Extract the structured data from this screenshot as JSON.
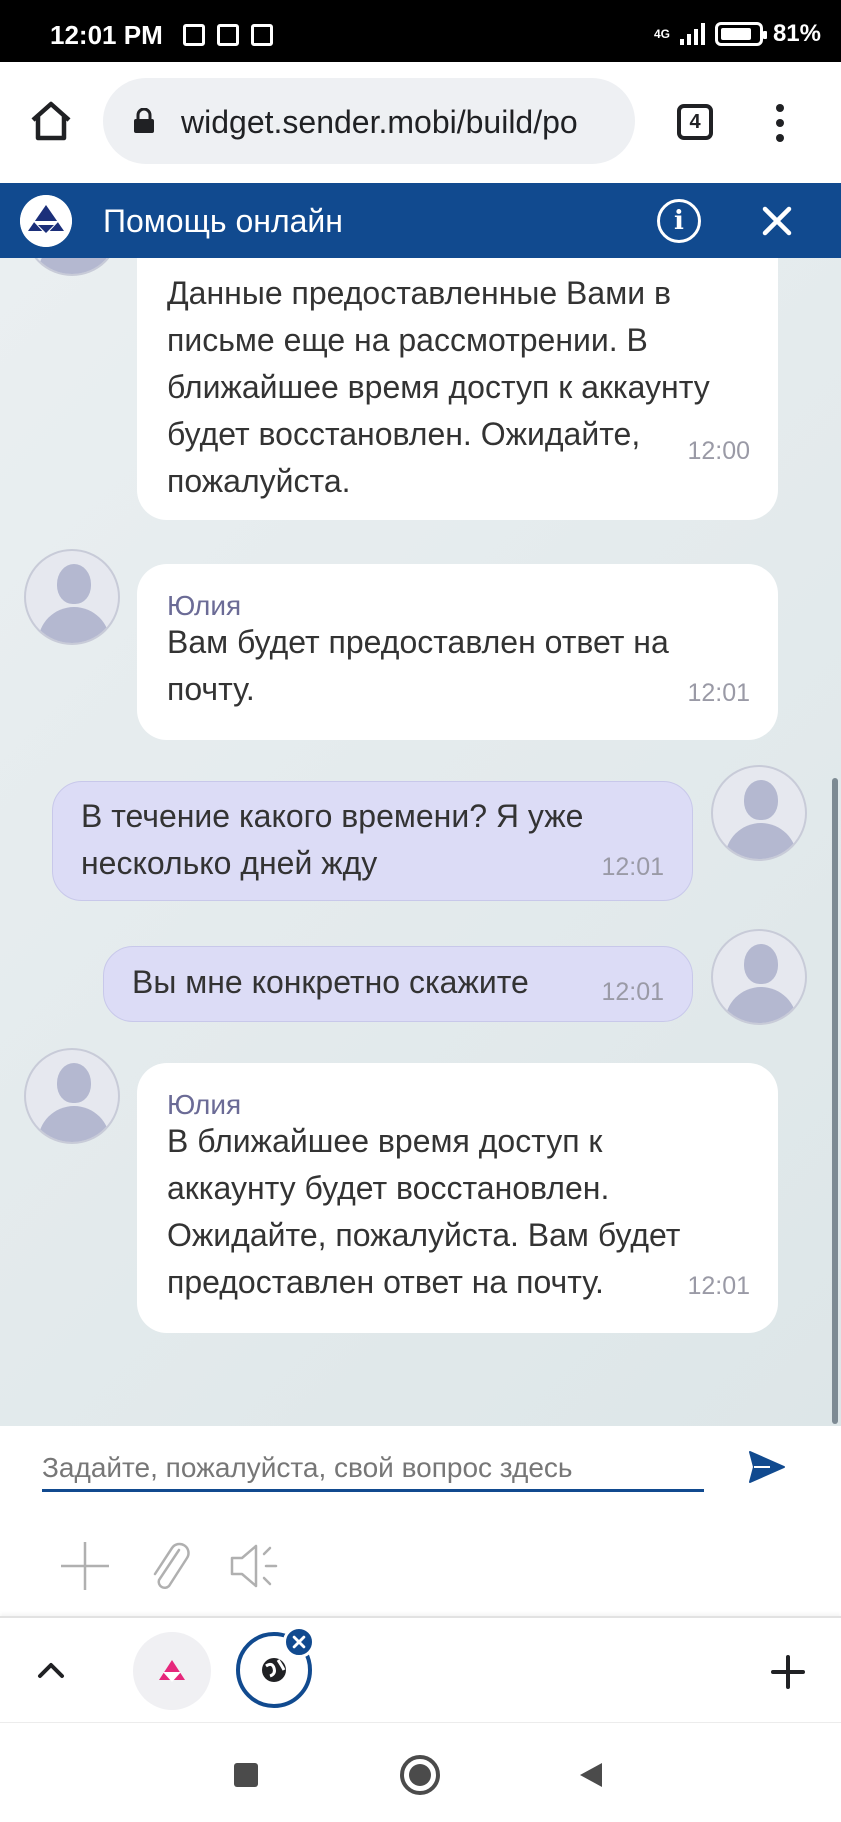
{
  "status_bar": {
    "time": "12:01 PM",
    "network": "4G",
    "battery": "81%"
  },
  "browser": {
    "url": "widget.sender.mobi/build/po",
    "tab_count": "4"
  },
  "widget": {
    "title": "Помощь онлайн",
    "info_label": "i",
    "accent_color": "#114a8f"
  },
  "messages": [
    {
      "direction": "incoming",
      "sender": "",
      "text": "Данные предоставленные Вами в письме еще на рассмотрении. В ближайшее время доступ к аккаунту будет восстановлен. Ожидайте, пожалуйста.",
      "time": "12:00"
    },
    {
      "direction": "incoming",
      "sender": "Юлия",
      "text": "Вам будет предоставлен ответ на почту.",
      "time": "12:01"
    },
    {
      "direction": "outgoing",
      "sender": "",
      "text": "В течение какого времени? Я уже несколько дней жду",
      "time": "12:01"
    },
    {
      "direction": "outgoing",
      "sender": "",
      "text": "Вы мне конкретно скажите",
      "time": "12:01"
    },
    {
      "direction": "incoming",
      "sender": "Юлия",
      "text": "В ближайшее время доступ к аккаунту будет восстановлен. Ожидайте, пожалуйста. Вам будет предоставлен ответ на почту.",
      "time": "12:01"
    }
  ],
  "composer": {
    "placeholder": "Задайте, пожалуйста, свой вопрос здесь",
    "value": ""
  },
  "icons": {
    "home": "home-icon",
    "lock": "lock-icon",
    "menu": "more-vert-icon",
    "info": "info-icon",
    "close": "close-icon",
    "send": "send-icon",
    "add": "plus-icon",
    "attach": "paperclip-icon",
    "audio": "speaker-icon",
    "chevron": "chevron-up-icon"
  }
}
